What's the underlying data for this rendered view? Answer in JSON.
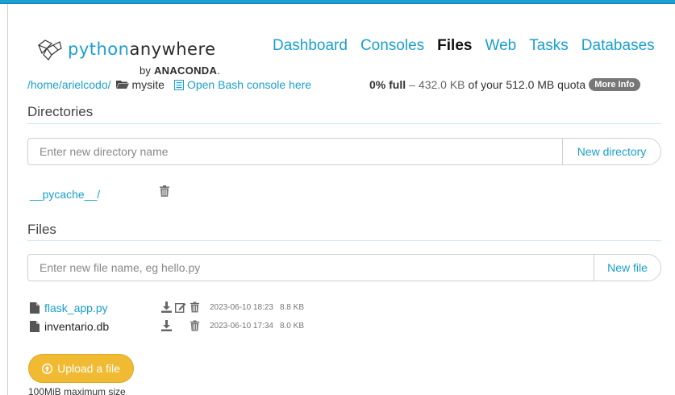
{
  "brand": {
    "logo_text_part1": "python",
    "logo_text_part2": "anywhere",
    "by": "by",
    "anaconda": "ANACONDA"
  },
  "nav": {
    "items": [
      {
        "label": "Dashboard",
        "active": false
      },
      {
        "label": "Consoles",
        "active": false
      },
      {
        "label": "Files",
        "active": true
      },
      {
        "label": "Web",
        "active": false
      },
      {
        "label": "Tasks",
        "active": false
      },
      {
        "label": "Databases",
        "active": false
      }
    ]
  },
  "breadcrumb": {
    "root": "/home/",
    "user": "arielcodo/",
    "current": "mysite",
    "bash_link": "Open Bash console here"
  },
  "quota": {
    "full": "0% full",
    "dash": "–",
    "used": "432.0 KB",
    "of_your": "of your",
    "total": "512.0 MB quota",
    "more_info": "More Info"
  },
  "directories": {
    "title": "Directories",
    "input_placeholder": "Enter new directory name",
    "button_label": "New directory",
    "items": [
      {
        "name": "__pycache__/"
      }
    ]
  },
  "files": {
    "title": "Files",
    "input_placeholder": "Enter new file name, eg hello.py",
    "button_label": "New file",
    "items": [
      {
        "name": "flask_app.py",
        "modified": "2023-06-10 18:23",
        "size": "8.8 KB",
        "editable": true
      },
      {
        "name": "inventario.db",
        "modified": "2023-06-10 17:34",
        "size": "8.0 KB",
        "editable": false
      }
    ]
  },
  "upload": {
    "button_label": "Upload a file",
    "max_size": "100MiB maximum size"
  },
  "colors": {
    "accent": "#1a9fd0",
    "upload": "#f0ba32",
    "badge": "#777777"
  }
}
